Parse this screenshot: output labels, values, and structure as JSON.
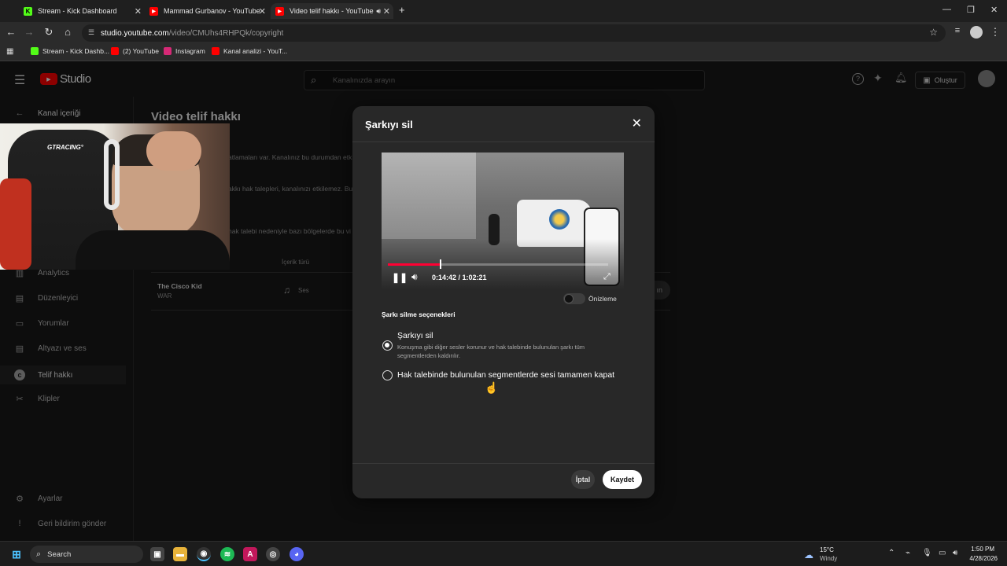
{
  "browser": {
    "tabs": [
      {
        "label": "Stream - Kick Dashboard",
        "icon": "kick-icon",
        "color": "#53fc18"
      },
      {
        "label": "Mammad Gurbanov - YouTube",
        "icon": "youtube-icon",
        "color": "#ff0000"
      },
      {
        "label": "Video telif hakkı - YouTube",
        "icon": "youtube-icon",
        "color": "#ff0000"
      }
    ],
    "new_tab": "+",
    "url_host": "studio.youtube.com",
    "url_path": "/video/CMUhs4RHPQk/copyright",
    "bookmarks": [
      {
        "label": "Stream - Kick Dashb...",
        "color": "#53fc18"
      },
      {
        "label": "(2) YouTube",
        "color": "#ff0000"
      },
      {
        "label": "Instagram",
        "color": "#d62976"
      },
      {
        "label": "Kanal analizi - YouT...",
        "color": "#ff0000"
      }
    ]
  },
  "studio": {
    "logo_text": "Studio",
    "search_placeholder": "Kanalınızda arayın",
    "create_label": "Oluştur",
    "back_label": "Kanal içeriği",
    "page_title": "Video telif hakkı",
    "sidebar": [
      {
        "label": "Analytics",
        "icon": "analytics-icon"
      },
      {
        "label": "Düzenleyici",
        "icon": "editor-icon"
      },
      {
        "label": "Yorumlar",
        "icon": "comments-icon"
      },
      {
        "label": "Altyazı ve ses",
        "icon": "subtitles-icon"
      },
      {
        "label": "Telif hakkı",
        "icon": "copyright-icon"
      },
      {
        "label": "Klipler",
        "icon": "scissors-icon"
      }
    ],
    "sidebar_bottom": [
      {
        "label": "Ayarlar",
        "icon": "gear-icon"
      },
      {
        "label": "Geri bildirim gönder",
        "icon": "feedback-icon"
      }
    ],
    "bg_texts": [
      "atlamaları var. Kanalınız bu durumdan etk",
      "akkı hak talepleri, kanalınızı etkilemez. Bu",
      "hak talebi nedeniyle bazı bölgelerde bu vi"
    ],
    "col_header": "İçerik türü",
    "row": {
      "title": "The Cisco Kid",
      "artist": "WAR",
      "type": "Ses",
      "right_btn": "ın"
    }
  },
  "dialog": {
    "title": "Şarkıyı sil",
    "player": {
      "time": "0:14:42 / 1:02:21",
      "progress": 0.235
    },
    "preview_label": "Önizleme",
    "section_title": "Şarkı silme seçenekleri",
    "options": [
      {
        "label": "Şarkıyı sil",
        "desc1": "Konuşma gibi diğer sesler korunur ve hak talebinde bulunulan şarkı tüm",
        "desc2": "segmentlerden kaldırılır.",
        "selected": true
      },
      {
        "label": "Hak talebinde bulunulan segmentlerde sesi tamamen kapat",
        "selected": false
      }
    ],
    "cancel": "İptal",
    "save": "Kaydet"
  },
  "taskbar": {
    "search": "Search",
    "weather_temp": "15°C",
    "weather_desc": "Windy",
    "time": "1:50 PM",
    "date": "4/28/2026"
  }
}
